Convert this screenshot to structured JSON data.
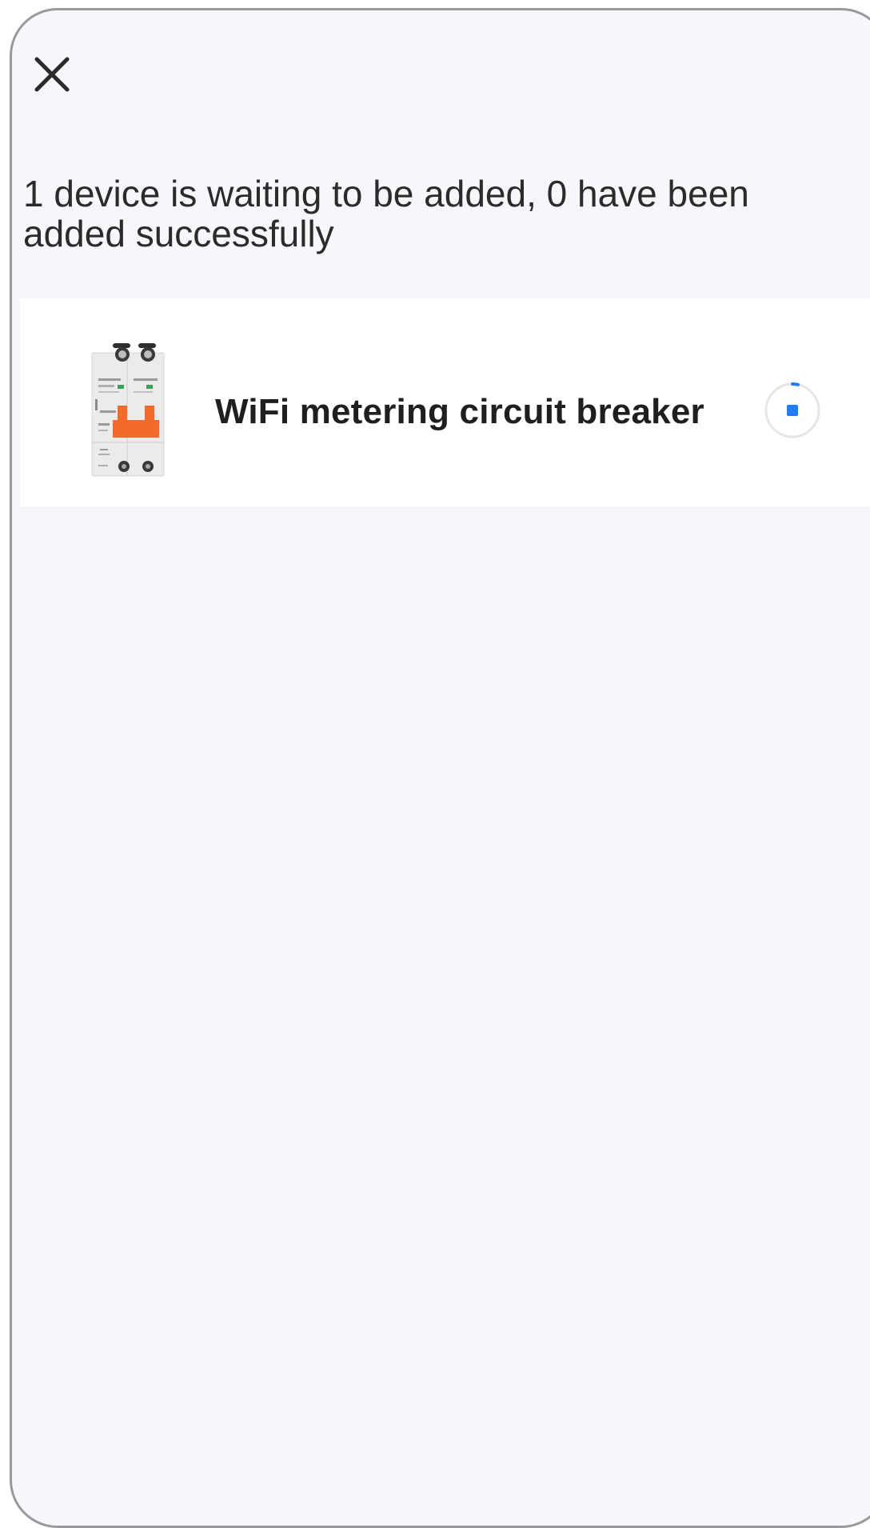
{
  "header": {
    "close_icon": "close-icon"
  },
  "status": {
    "text": "1 device is waiting to be added, 0 have been added successfully"
  },
  "devices": [
    {
      "name": "WiFi metering circuit breaker",
      "image_icon": "circuit-breaker-image",
      "state_icon": "loading-spinner-icon"
    }
  ],
  "colors": {
    "background": "#f6f7fb",
    "card": "#ffffff",
    "accent": "#1f7cf2",
    "breaker_handle": "#f36a2a"
  }
}
